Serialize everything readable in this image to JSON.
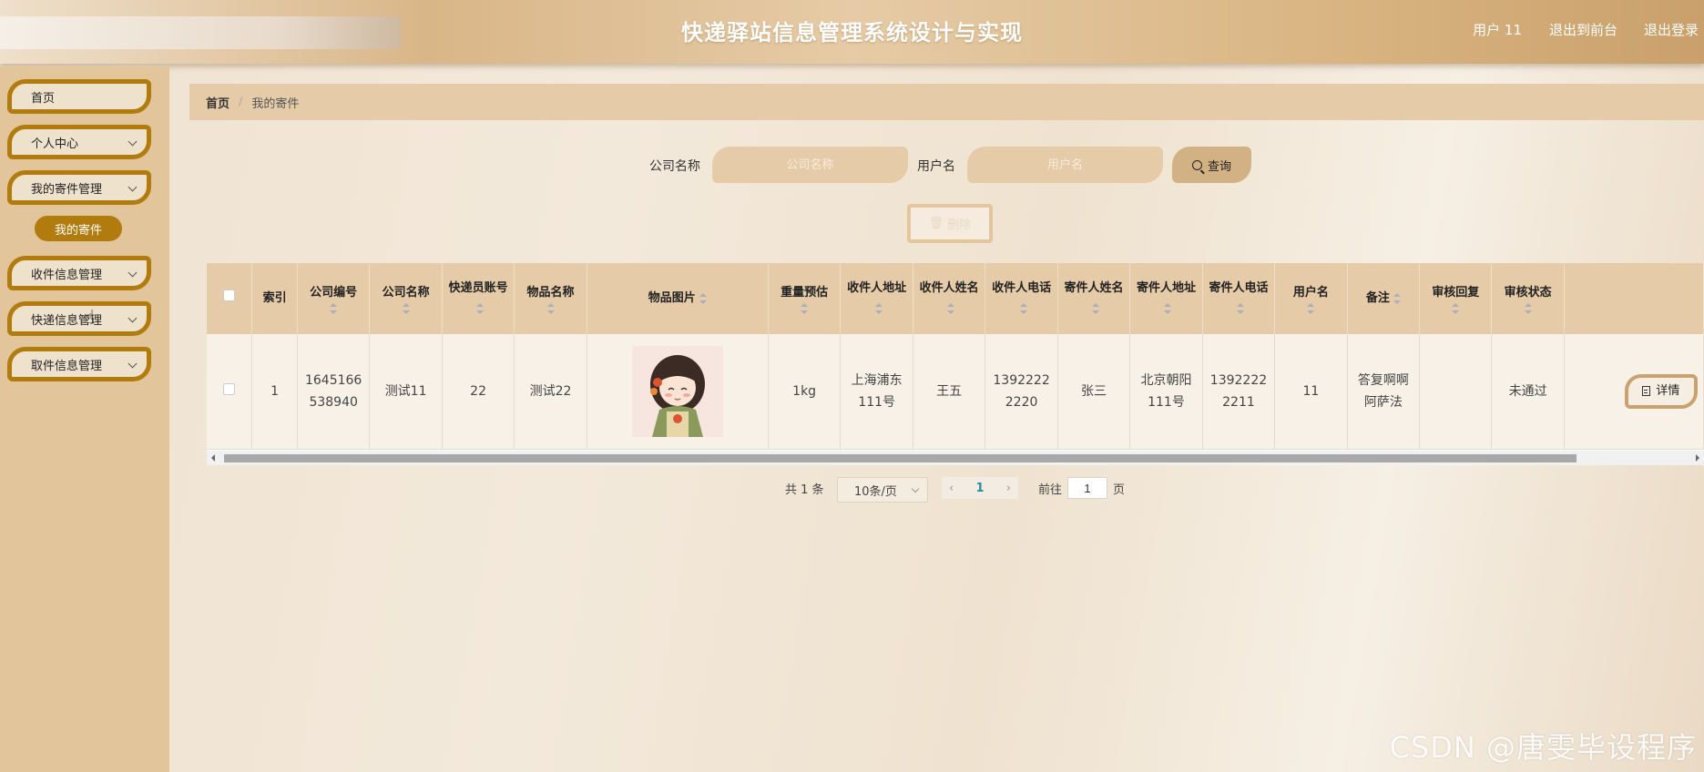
{
  "header": {
    "title": "快递驿站信息管理系统设计与实现",
    "user": "用户 11",
    "front_link": "退出到前台",
    "logout_link": "退出登录"
  },
  "sidebar": {
    "items": [
      {
        "label": "首页"
      },
      {
        "label": "个人中心"
      },
      {
        "label": "我的寄件管理"
      },
      {
        "label": "收件信息管理"
      },
      {
        "label": "快递信息管理"
      },
      {
        "label": "取件信息管理"
      }
    ],
    "active_sub": "我的寄件"
  },
  "breadcrumb": {
    "home": "首页",
    "separator": "/",
    "current": "我的寄件"
  },
  "search": {
    "company_label": "公司名称",
    "company_placeholder": "公司名称",
    "username_label": "用户名",
    "username_placeholder": "用户名",
    "query_label": "查询"
  },
  "toolbar": {
    "delete_label": "删除"
  },
  "table": {
    "headers": [
      "索引",
      "公司编号",
      "公司名称",
      "快递员账号",
      "物品名称",
      "物品图片",
      "重量预估",
      "收件人地址",
      "收件人姓名",
      "收件人电话",
      "寄件人姓名",
      "寄件人地址",
      "寄件人电话",
      "用户名",
      "备注",
      "审核回复",
      "审核状态"
    ],
    "rows": [
      {
        "index": "1",
        "company_no": "1645166538940",
        "company_name": "测试11",
        "courier": "22",
        "item_name": "测试22",
        "image": "cartoon-girl-avatar",
        "weight": "1kg",
        "recipient_address": "上海浦东111号",
        "recipient_name": "王五",
        "recipient_phone": "13922222220",
        "sender_name": "张三",
        "sender_address": "北京朝阳111号",
        "sender_phone": "13922222211",
        "username": "11",
        "remark": "答复啊啊阿萨法",
        "review_reply": "",
        "review_status": "未通过",
        "detail_label": "详情"
      }
    ]
  },
  "pagination": {
    "total": "共 1 条",
    "page_size": "10条/页",
    "current_page": "1",
    "goto_label": "前往",
    "goto_value": "1",
    "page_unit": "页"
  },
  "watermark": "CSDN @唐雯毕设程序"
}
